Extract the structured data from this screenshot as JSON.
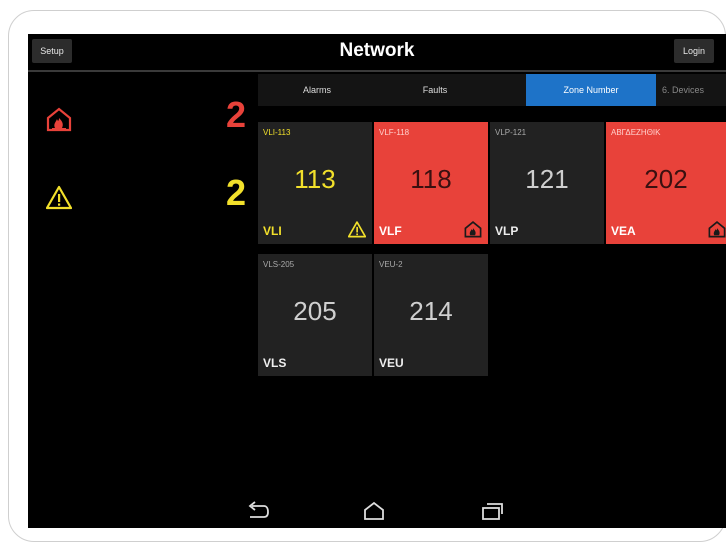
{
  "header": {
    "title": "Network",
    "setup_label": "Setup",
    "login_label": "Login"
  },
  "colors": {
    "alarm": "#e8423a",
    "fault": "#f2e02b",
    "active_tab": "#1e73c8"
  },
  "summary": [
    {
      "icon": "fire-alarm-icon",
      "count": "2"
    },
    {
      "icon": "warning-triangle-icon",
      "count": "2"
    }
  ],
  "tabs": [
    {
      "label": "Alarms",
      "active": false
    },
    {
      "label": "Faults",
      "active": false
    },
    {
      "label": "Zone Number",
      "active": true
    },
    {
      "label": "6. Devices",
      "active": false
    }
  ],
  "zones": [
    {
      "zone_id": "VLI-113",
      "number": "113",
      "type": "VLI",
      "state": "fault",
      "icon": "warning-triangle-icon"
    },
    {
      "zone_id": "VLF-118",
      "number": "118",
      "type": "VLF",
      "state": "alarm",
      "icon": "fire-alarm-icon"
    },
    {
      "zone_id": "VLP-121",
      "number": "121",
      "type": "VLP",
      "state": "normal",
      "icon": ""
    },
    {
      "zone_id": "ΑΒΓΔΕΖΗΘΙΚ",
      "number": "202",
      "type": "VEA",
      "state": "alarm",
      "icon": "fire-alarm-icon"
    },
    {
      "zone_id": "VLS-205",
      "number": "205",
      "type": "VLS",
      "state": "normal",
      "icon": ""
    },
    {
      "zone_id": "VEU-2",
      "number": "214",
      "type": "VEU",
      "state": "normal",
      "icon": ""
    }
  ],
  "navbar": {
    "back": "back-icon",
    "home": "home-icon",
    "recents": "recents-icon"
  }
}
